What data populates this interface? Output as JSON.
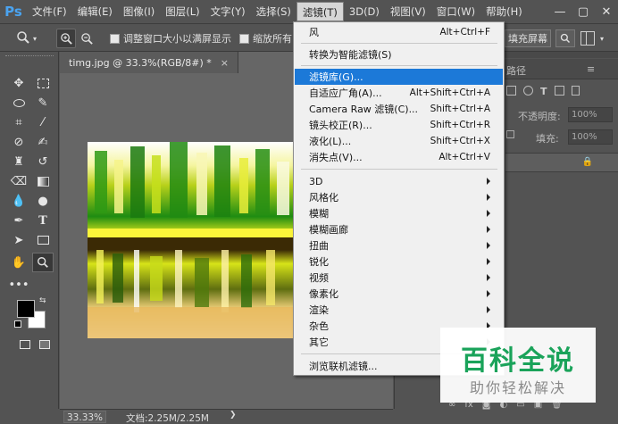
{
  "app": {
    "logo": "Ps"
  },
  "menubar": {
    "items": [
      "文件(F)",
      "编辑(E)",
      "图像(I)",
      "图层(L)",
      "文字(Y)",
      "选择(S)",
      "滤镜(T)",
      "3D(D)",
      "视图(V)",
      "窗口(W)",
      "帮助(H)"
    ],
    "active_index": 6
  },
  "window_controls": {
    "minimize": "—",
    "maximize": "▢",
    "close": "✕"
  },
  "options": {
    "resize_windows": "调整窗口大小以满屏显示",
    "zoom_all": "缩放所有",
    "fill_screen": "填充屏幕"
  },
  "document": {
    "tab_title": "timg.jpg @ 33.3%(RGB/8#) *",
    "tab_close": "×"
  },
  "status": {
    "zoom": "33.33%",
    "doc_size": "文档:2.25M/2.25M"
  },
  "panel": {
    "tab_partial": "路径",
    "opacity_label": "不透明度:",
    "opacity_value": "100%",
    "fill_label": "填充:",
    "fill_value": "100%"
  },
  "filter_menu": {
    "items": [
      {
        "label": "风",
        "shortcut": "Alt+Ctrl+F"
      },
      {
        "label": "转换为智能滤镜(S)",
        "shortcut": ""
      },
      {
        "label": "滤镜库(G)...",
        "shortcut": "",
        "highlighted": true
      },
      {
        "label": "自适应广角(A)...",
        "shortcut": "Alt+Shift+Ctrl+A"
      },
      {
        "label": "Camera Raw 滤镜(C)...",
        "shortcut": "Shift+Ctrl+A"
      },
      {
        "label": "镜头校正(R)...",
        "shortcut": "Shift+Ctrl+R"
      },
      {
        "label": "液化(L)...",
        "shortcut": "Shift+Ctrl+X"
      },
      {
        "label": "消失点(V)...",
        "shortcut": "Alt+Ctrl+V"
      },
      {
        "label": "3D",
        "submenu": true
      },
      {
        "label": "风格化",
        "submenu": true
      },
      {
        "label": "模糊",
        "submenu": true
      },
      {
        "label": "模糊画廊",
        "submenu": true
      },
      {
        "label": "扭曲",
        "submenu": true
      },
      {
        "label": "锐化",
        "submenu": true
      },
      {
        "label": "视频",
        "submenu": true
      },
      {
        "label": "像素化",
        "submenu": true
      },
      {
        "label": "渲染",
        "submenu": true
      },
      {
        "label": "杂色",
        "submenu": true
      },
      {
        "label": "其它",
        "submenu": true
      },
      {
        "label": "浏览联机滤镜...",
        "shortcut": ""
      }
    ]
  },
  "watermark": {
    "title": "百科全说",
    "subtitle": "助你轻松解决"
  },
  "colors": {
    "accent": "#1c79d8",
    "brand": "#4aa3f0",
    "watermark_green": "#1aa35a"
  }
}
